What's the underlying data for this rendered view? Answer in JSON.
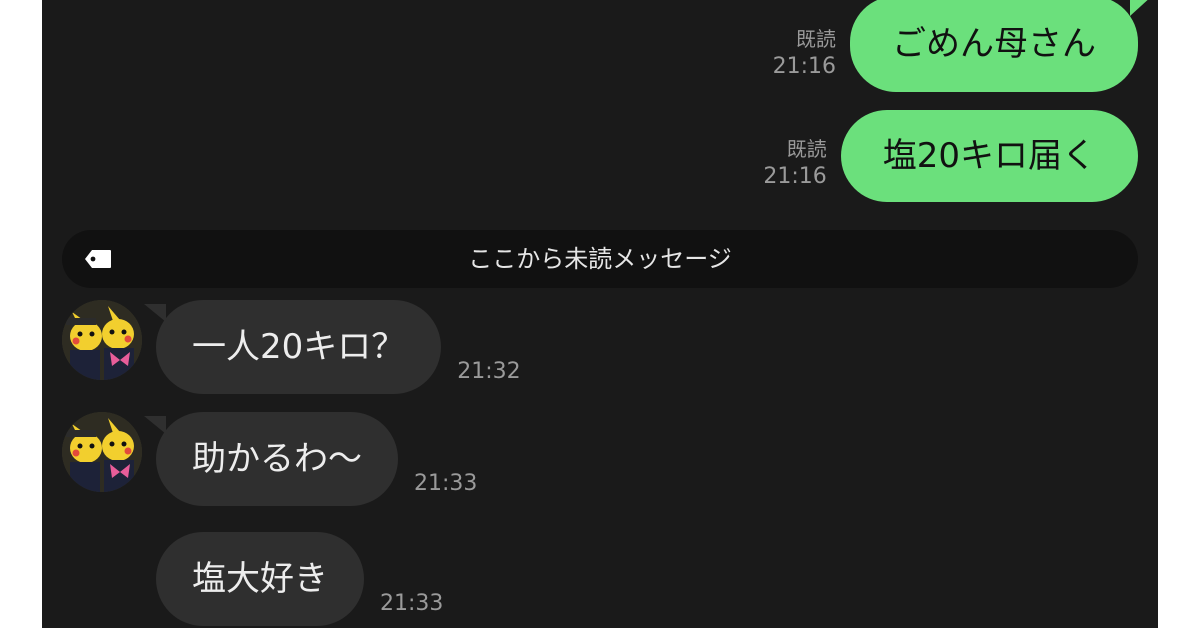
{
  "outgoing": [
    {
      "read": "既読",
      "time": "21:16",
      "text": "ごめん母さん"
    },
    {
      "read": "既読",
      "time": "21:16",
      "text": "塩20キロ届く"
    }
  ],
  "divider": {
    "label": "ここから未読メッセージ",
    "icon": "tag-icon"
  },
  "incoming": [
    {
      "text": "一人20キロ？",
      "time": "21:32",
      "avatar": "pikachu-avatar"
    },
    {
      "text": "助かるわ〜",
      "time": "21:33",
      "avatar": "pikachu-avatar"
    },
    {
      "text": "塩大好き",
      "time": "21:33"
    }
  ],
  "colors": {
    "background": "#1a1a1a",
    "outgoing_bubble": "#6be07c",
    "incoming_bubble": "#2f2f2f",
    "meta_text": "#9a9a9a"
  }
}
